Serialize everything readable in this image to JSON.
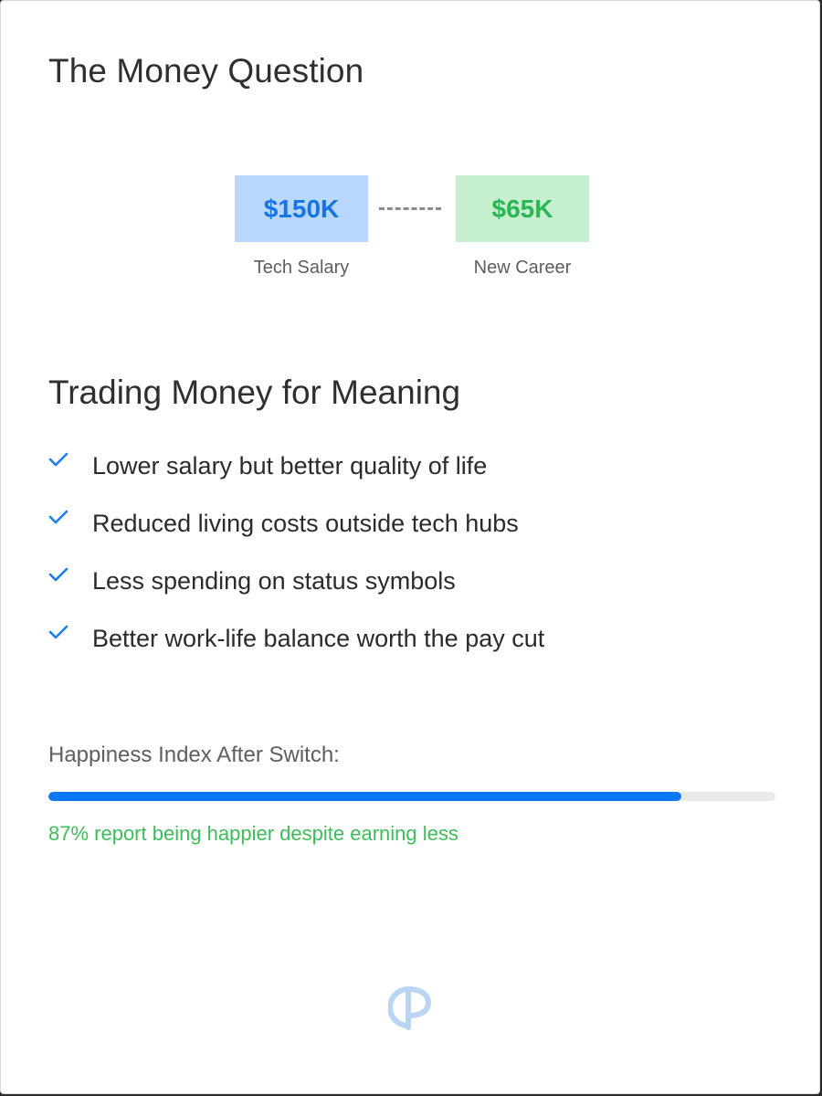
{
  "header": {
    "title": "The Money Question"
  },
  "comparison": {
    "tech": {
      "amount": "$150K",
      "label": "Tech Salary",
      "bg_color": "#b8d7fb",
      "text_color": "#1774e6"
    },
    "new_career": {
      "amount": "$65K",
      "label": "New Career",
      "bg_color": "#c6efd0",
      "text_color": "#2cb553"
    }
  },
  "section": {
    "title": "Trading Money for Meaning",
    "check_icon": "check-icon",
    "items": [
      {
        "text": "Lower salary but better quality of life"
      },
      {
        "text": "Reduced living costs outside tech hubs"
      },
      {
        "text": "Less spending on status symbols"
      },
      {
        "text": "Better work-life balance worth the pay cut"
      }
    ]
  },
  "happiness": {
    "label": "Happiness Index After Switch:",
    "percent": 87,
    "bar_color": "#0b79f4",
    "caption": "87% report being happier despite earning less",
    "caption_color": "#3cbd5a"
  },
  "footer": {
    "logo_icon": "cp-logo-icon"
  }
}
